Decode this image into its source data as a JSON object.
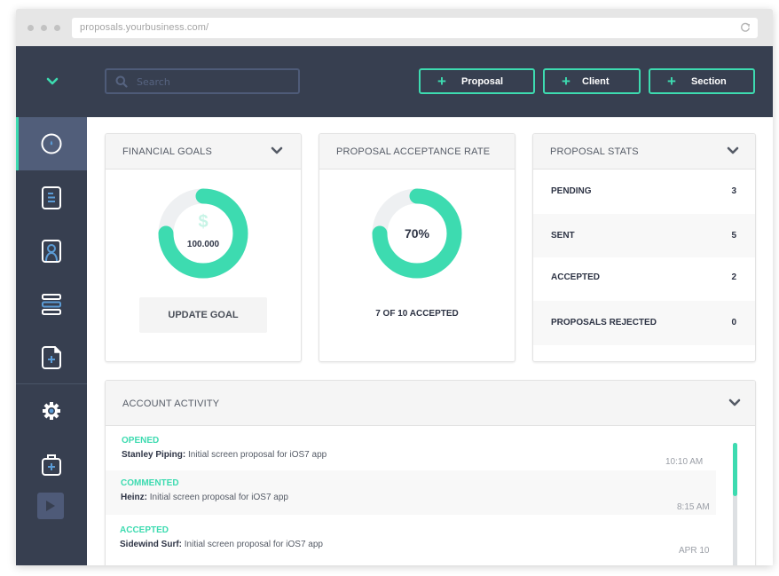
{
  "browser": {
    "url": "proposals.yourbusiness.com/",
    "icons": {
      "reload": "reload-icon"
    }
  },
  "header": {
    "search_placeholder": "Search",
    "search_value": "",
    "buttons": [
      {
        "label": "Proposal",
        "icon": "plus-icon"
      },
      {
        "label": "Client",
        "icon": "plus-icon"
      },
      {
        "label": "Section",
        "icon": "plus-icon"
      }
    ]
  },
  "sidebar": {
    "items": [
      {
        "name": "dashboard",
        "icon": "drop-circle-icon",
        "active": true
      },
      {
        "name": "documents",
        "icon": "document-lines-icon",
        "active": false
      },
      {
        "name": "contacts",
        "icon": "contact-card-icon",
        "active": false
      },
      {
        "name": "sections",
        "icon": "stack-rows-icon",
        "active": false
      },
      {
        "name": "new-document",
        "icon": "document-add-icon",
        "active": false
      },
      {
        "name": "settings",
        "icon": "gear-icon",
        "active": false
      },
      {
        "name": "add-case",
        "icon": "briefcase-add-icon",
        "active": false
      }
    ],
    "play_icon": "play-icon"
  },
  "financial_goals": {
    "title": "FINANCIAL GOALS",
    "currency_symbol": "$",
    "goal_amount": "100.000",
    "progress": 0.75,
    "button_label": "UPDATE GOAL"
  },
  "acceptance_rate": {
    "title": "PROPOSAL ACCEPTANCE RATE",
    "percent_label": "70%",
    "progress": 0.75,
    "summary": "7 OF 10 ACCEPTED"
  },
  "proposal_stats": {
    "title": "PROPOSAL STATS",
    "rows": [
      {
        "label": "PENDING",
        "value": "3"
      },
      {
        "label": "SENT",
        "value": "5"
      },
      {
        "label": "ACCEPTED",
        "value": "2"
      },
      {
        "label": "PROPOSALS REJECTED",
        "value": "0"
      }
    ]
  },
  "account_activity": {
    "title": "ACCOUNT ACTIVITY",
    "items": [
      {
        "status": "OPENED",
        "client": "Stanley Piping:",
        "description": " Initial screen proposal for iOS7 app",
        "time": "10:10 AM"
      },
      {
        "status": "COMMENTED",
        "client": "Heinz:",
        "description": " Initial screen proposal for iOS7 app",
        "time": "8:15 AM"
      },
      {
        "status": "ACCEPTED",
        "client": "Sidewind Surf:",
        "description": " Initial screen proposal for iOS7 app",
        "time": "APR 10"
      }
    ],
    "scroll_position": 0.0
  },
  "colors": {
    "accent": "#3ddbb0",
    "navy": "#373f50",
    "active_nav": "#515e7a",
    "icon_blue": "#5b9bd5",
    "track": "#eef0f2"
  }
}
